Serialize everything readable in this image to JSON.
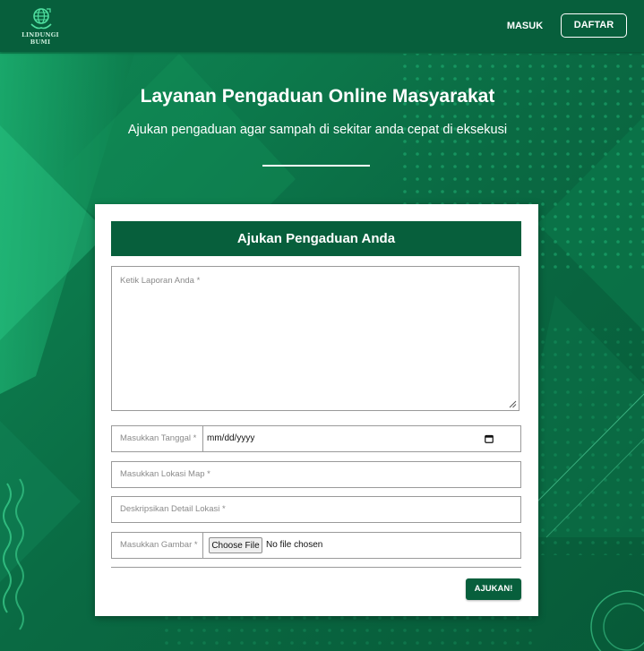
{
  "brand": {
    "name": "LINDUNGI BUMI",
    "logo_icon": "globe-hands-icon"
  },
  "nav": {
    "login_label": "MASUK",
    "register_label": "DAFTAR"
  },
  "hero": {
    "title": "Layanan Pengaduan Online Masyarakat",
    "subtitle": "Ajukan pengaduan agar sampah di sekitar anda cepat di eksekusi"
  },
  "form": {
    "header": "Ajukan Pengaduan Anda",
    "report_placeholder": "Ketik Laporan Anda *",
    "date_label": "Masukkan Tanggal *",
    "date_value": "mm/dd/yyyy",
    "location_placeholder": "Masukkan Lokasi Map *",
    "detail_placeholder": "Deskripsikan Detail Lokasi *",
    "image_label": "Masukkan Gambar *",
    "file_button_label": "Choose File",
    "file_status": "No file chosen",
    "submit_label": "AJUKAN!"
  },
  "colors": {
    "primary": "#075f3c",
    "background": "#0a6a43",
    "accent_light": "#1fbf7a",
    "card": "#ffffff"
  }
}
